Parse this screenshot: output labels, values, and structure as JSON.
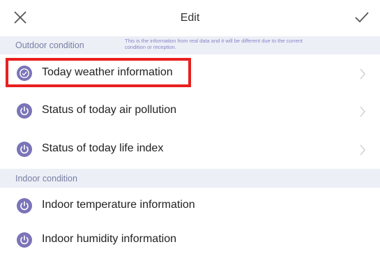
{
  "header": {
    "title": "Edit",
    "close_icon": "close-icon",
    "confirm_icon": "checkmark-icon"
  },
  "outdoor": {
    "label": "Outdoor condition",
    "note_line1": "This is the information from real data and it will be different due to the current",
    "note_line2": "condition or reception.",
    "items": [
      {
        "label": "Today weather information",
        "icon": "check-circle-icon",
        "chevron": true,
        "highlighted": true
      },
      {
        "label": "Status of today air pollution",
        "icon": "power-icon",
        "chevron": true
      },
      {
        "label": "Status of today life index",
        "icon": "power-icon",
        "chevron": true
      }
    ]
  },
  "indoor": {
    "label": "Indoor condition",
    "items": [
      {
        "label": "Indoor temperature information",
        "icon": "power-icon"
      },
      {
        "label": "Indoor humidity information",
        "icon": "power-icon"
      }
    ]
  },
  "colors": {
    "accent": "#7a74b8",
    "section_bg": "#eceff6",
    "highlight": "#e8201f"
  }
}
